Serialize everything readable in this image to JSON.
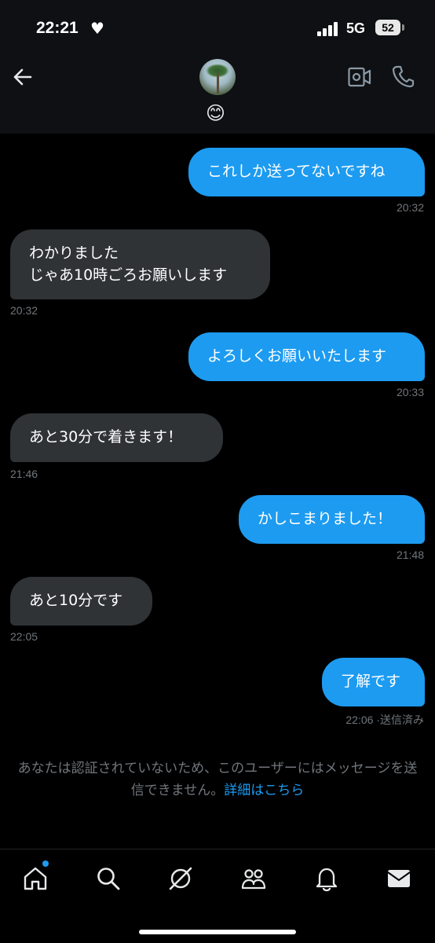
{
  "status_bar": {
    "time": "22:21",
    "network": "5G",
    "battery": "52"
  },
  "header": {
    "status_emoji": "😊"
  },
  "messages": [
    {
      "dir": "out",
      "text": "これしか送ってないですね",
      "time": "20:32"
    },
    {
      "dir": "in",
      "text": "わかりました\nじゃあ10時ごろお願いします",
      "time": "20:32"
    },
    {
      "dir": "out",
      "text": "よろしくお願いいたします",
      "time": "20:33"
    },
    {
      "dir": "in",
      "text": "あと30分で着きます！",
      "time": "21:46"
    },
    {
      "dir": "out",
      "text": "かしこまりました！",
      "time": "21:48"
    },
    {
      "dir": "in",
      "text": "あと10分です",
      "time": "22:05"
    },
    {
      "dir": "out",
      "text": "了解です",
      "time": "22:06",
      "receipt": "送信済み"
    }
  ],
  "notice": {
    "text": "あなたは認証されていないため、このユーザーにはメッセージを送信できません。",
    "link": "詳細はこちら"
  },
  "bottom_nav": [
    "home-icon",
    "search-icon",
    "grok-icon",
    "communities-icon",
    "notifications-icon",
    "messages-icon"
  ],
  "colors": {
    "accent": "#1d9bf0",
    "incoming_bubble": "#2f3336",
    "background": "#000000"
  }
}
